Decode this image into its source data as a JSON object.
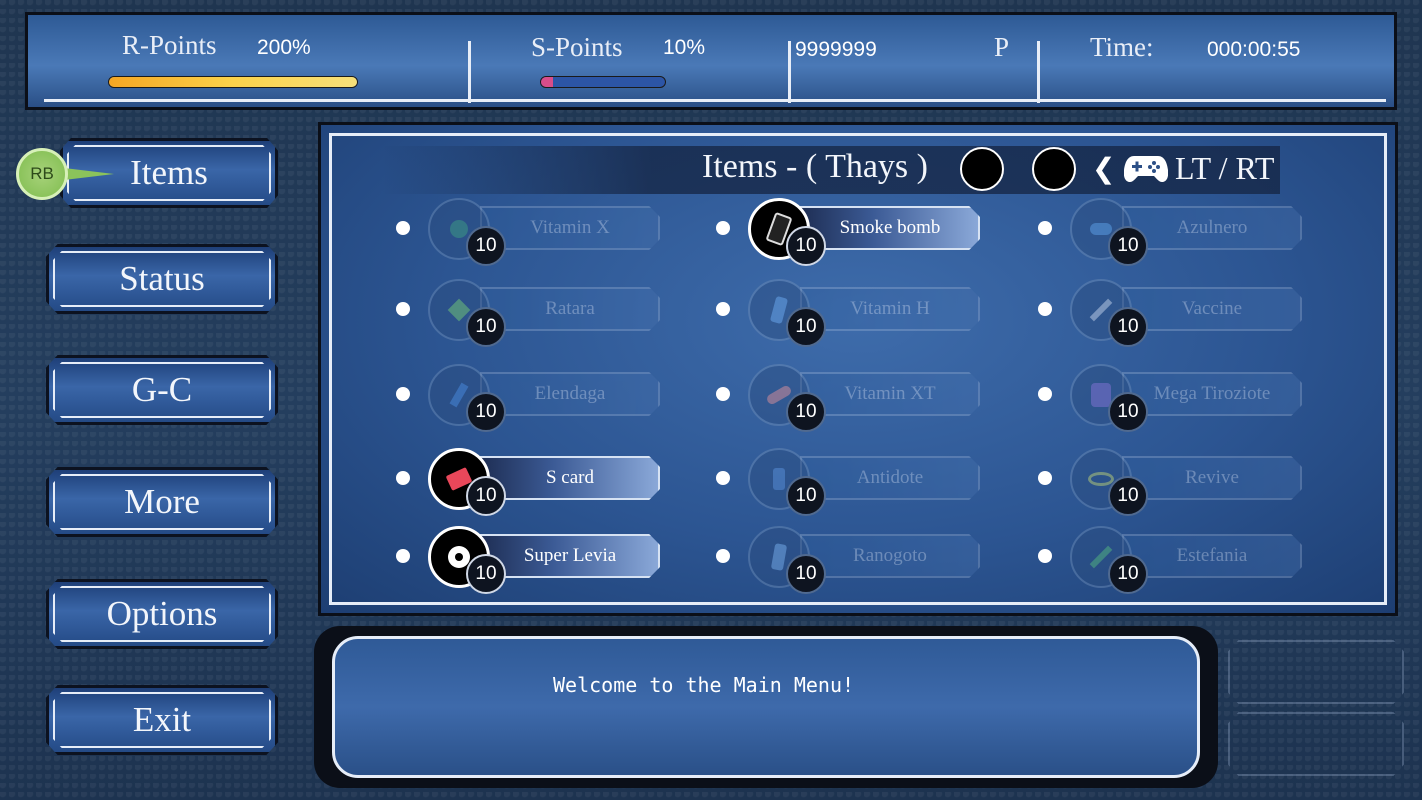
{
  "top": {
    "r_points_label": "R-Points",
    "r_points_value": "200%",
    "r_points_fill": 1.0,
    "s_points_label": "S-Points",
    "s_points_value": "10%",
    "s_points_fill": 0.1,
    "currency_amount": "9999999",
    "currency_unit": "P",
    "time_label": "Time:",
    "time_value": "000:00:55"
  },
  "menu": {
    "rb_badge": "RB",
    "items": [
      {
        "label": "Items",
        "active": true
      },
      {
        "label": "Status"
      },
      {
        "label": "G-C"
      },
      {
        "label": "More"
      },
      {
        "label": "Options"
      },
      {
        "label": "Exit"
      }
    ]
  },
  "panel": {
    "title": "Items - ( Thays )",
    "switch_hint": "LT / RT",
    "items": [
      {
        "name": "Vitamin X",
        "count": "10",
        "available": false,
        "icon": "green-orb-icon"
      },
      {
        "name": "Smoke bomb",
        "count": "10",
        "available": true,
        "icon": "smoke-bomb-icon"
      },
      {
        "name": "Azulnero",
        "count": "10",
        "available": false,
        "icon": "blue-pills-icon"
      },
      {
        "name": "Ratara",
        "count": "10",
        "available": false,
        "icon": "candy-icon"
      },
      {
        "name": "Vitamin H",
        "count": "10",
        "available": false,
        "icon": "bottle-icon"
      },
      {
        "name": "Vaccine",
        "count": "10",
        "available": false,
        "icon": "syringe-icon"
      },
      {
        "name": "Elendaga",
        "count": "10",
        "available": false,
        "icon": "bandage-icon"
      },
      {
        "name": "Vitamin XT",
        "count": "10",
        "available": false,
        "icon": "capsule-icon"
      },
      {
        "name": "Mega Tiroziote",
        "count": "10",
        "available": false,
        "icon": "jar-icon"
      },
      {
        "name": "S card",
        "count": "10",
        "available": true,
        "icon": "card-icon"
      },
      {
        "name": "Antidote",
        "count": "10",
        "available": false,
        "icon": "vial-icon"
      },
      {
        "name": "Revive",
        "count": "10",
        "available": false,
        "icon": "halo-icon"
      },
      {
        "name": "Super Levia",
        "count": "10",
        "available": true,
        "icon": "eye-orb-icon"
      },
      {
        "name": "Ranogoto",
        "count": "10",
        "available": false,
        "icon": "spray-icon"
      },
      {
        "name": "Estefania",
        "count": "10",
        "available": false,
        "icon": "green-syringe-icon"
      }
    ]
  },
  "message": "Welcome to the Main Menu!",
  "colors": {
    "r_bar": "#f2b21a",
    "s_bar_fill": "#d94d8a",
    "s_bar_bg": "#2c55a6",
    "rb_badge": "#8bc35b"
  }
}
